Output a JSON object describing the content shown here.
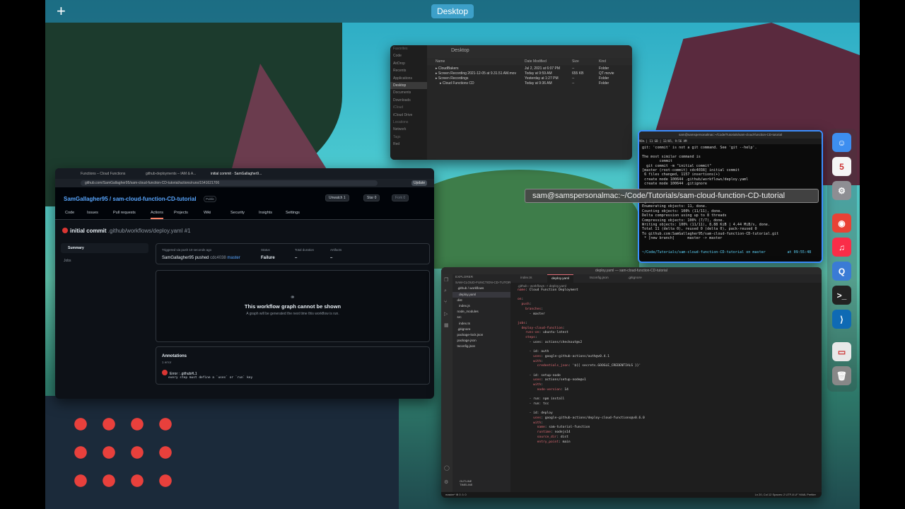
{
  "desktop": {
    "space_label": "Desktop",
    "add_space": "+"
  },
  "finder": {
    "title": "Desktop",
    "sidebar": [
      "Favorites",
      "Code",
      "AirDrop",
      "Recents",
      "Applications",
      "Desktop",
      "Documents",
      "Downloads",
      "iCloud",
      "iCloud Drive",
      "Locations",
      "Network",
      "Tags",
      "Red"
    ],
    "headers": {
      "name": "Name",
      "date": "Date Modified",
      "size": "Size",
      "kind": "Kind"
    },
    "rows": [
      {
        "name": "CloudBakers",
        "date": "Jul 2, 2021 at 6:07 PM",
        "size": "--",
        "kind": "Folder"
      },
      {
        "name": "Screen Recording 2021-12-05 at 9.31.51 AM.mov",
        "date": "Today at 9:59 AM",
        "size": "655 KB",
        "kind": "QT movie"
      },
      {
        "name": "Screen Recordings",
        "date": "Yesterday at 1:27 PM",
        "size": "--",
        "kind": "Folder"
      },
      {
        "name": "Cloud Functions CD",
        "date": "Today at 9:36 AM",
        "size": "--",
        "kind": "Folder"
      }
    ]
  },
  "browser": {
    "tabs": [
      "Functions – Cloud Functions",
      "github-deployments – IAM & A...",
      "initial commit · SamGallagher9..."
    ],
    "url": "github.com/SamGallagher95/sam-cloud-function-CD-tutorial/actions/runs/1541621706",
    "update": "Update",
    "repo": "SamGallagher95 / sam-cloud-function-CD-tutorial",
    "public": "Public",
    "unwatch": "Unwatch",
    "unwatch_count": "1",
    "star": "Star",
    "star_count": "0",
    "fork": "Fork",
    "fork_count": "0",
    "nav": [
      "Code",
      "Issues",
      "Pull requests",
      "Actions",
      "Projects",
      "Wiki",
      "Security",
      "Insights",
      "Settings"
    ],
    "run_title": "initial commit",
    "run_sub": ".github/workflows/deploy.yaml #1",
    "side_summary": "Summary",
    "side_jobs": "Jobs",
    "summary": {
      "trigger_label": "Triggered via push 10 seconds ago",
      "actor": "SamGallagher95 pushed",
      "commit": "cdc4038",
      "branch": "master",
      "status_label": "Status",
      "status": "Failure",
      "duration_label": "Total duration",
      "duration": "–",
      "artifacts_label": "Artifacts",
      "artifacts": "–"
    },
    "graph_title": "This workflow graph cannot be shown",
    "graph_sub": "A graph will be generated the next time this workflow is run.",
    "annotations_title": "Annotations",
    "annotations_count": "1 error",
    "error_title": "Error : .github#L1",
    "error_msg": "every step must define a `uses` or `run` key"
  },
  "terminal": {
    "title": "sam@samspersonalmac:~/Code/Tutorials/sam-cloud-function-CD-tutorial",
    "status": "96%   |   11 GB   |   12/05, 9:56 AM",
    "lines": [
      "git: 'commit' is not a git command. See 'git --help'.",
      "",
      "The most similar command is",
      "        commit",
      "  git commit -m \"initial commit\"",
      "[master (root-commit) cdc4038] initial commit",
      " 6 files changed, 1157 insertions(+)",
      " create mode 100644 .github/workflows/deploy.yaml",
      " create mode 100644 .gitignore",
      "",
      "",
      "",
      " git push",
      "Enumerating objects: 11, done.",
      "Counting objects: 100% (11/11), done.",
      "Delta compression using up to 8 threads",
      "Compressing objects: 100% (7/7), done.",
      "Writing objects: 100% (11/11), 8.88 KiB | 4.44 MiB/s, done.",
      "Total 11 (delta 0), reused 0 (delta 0), pack-reused 0",
      "To github.com:SamGallagher95/sam-cloud-function-CD-tutorial.git",
      " * [new branch]      master -> master"
    ],
    "prompt": "~/Code/Tutorials/sam-cloud-function-CD-tutorial on master          at 09:55:48",
    "tooltip": "sam@samspersonalmac:~/Code/Tutorials/sam-cloud-function-CD-tutorial"
  },
  "vscode": {
    "title": "deploy.yaml — sam-cloud-function-CD-tutorial",
    "explorer": [
      "EXPLORER",
      "SAM-CLOUD-FUNCTION-CD-TUTORIAL",
      "  .github / workflows",
      "    deploy.yaml",
      "  dist",
      "    index.js",
      "  node_modules",
      "  src",
      "    index.ts",
      "  .gitignore",
      "  package-lock.json",
      "  package.json",
      "  tsconfig.json"
    ],
    "tabs": [
      "index.ts",
      "deploy.yaml",
      "tsconfig.json",
      ".gitignore"
    ],
    "breadcrumb": ".github › workflows › ! deploy.yaml",
    "code": [
      [
        "name",
        ": Cloud Function Deployment"
      ],
      [
        "",
        ""
      ],
      [
        "on",
        ":"
      ],
      [
        "  push",
        ":"
      ],
      [
        "    branches",
        ":"
      ],
      [
        "",
        "      - master"
      ],
      [
        "",
        ""
      ],
      [
        "jobs",
        ":"
      ],
      [
        "  deploy-cloud-function",
        ":"
      ],
      [
        "    runs-on",
        ": ubuntu-latest"
      ],
      [
        "    steps",
        ":"
      ],
      [
        "",
        "      - uses: actions/checkout@v2"
      ],
      [
        "",
        ""
      ],
      [
        "",
        "      - id: auth"
      ],
      [
        "        uses",
        ": google-github-actions/auth@v0.4.1"
      ],
      [
        "        with",
        ":"
      ],
      [
        "          credentials_json",
        ": '${{ secrets.GOOGLE_CREDENTIALS }}'"
      ],
      [
        "",
        ""
      ],
      [
        "",
        "      - id: setup-node"
      ],
      [
        "        uses",
        ": actions/setup-node@v1"
      ],
      [
        "        with",
        ":"
      ],
      [
        "          node-version",
        ": 14"
      ],
      [
        "",
        ""
      ],
      [
        "",
        "      - run: npm install"
      ],
      [
        "",
        "      - run: tsc"
      ],
      [
        "",
        ""
      ],
      [
        "",
        "      - id: deploy"
      ],
      [
        "        uses",
        ": google-github-actions/deploy-cloud-functions@v0.6.0"
      ],
      [
        "        with",
        ":"
      ],
      [
        "          name",
        ": sam-tutorial-function"
      ],
      [
        "          runtime",
        ": nodejs14"
      ],
      [
        "          source_dir",
        ": dist"
      ],
      [
        "          entry_point",
        ": main"
      ]
    ],
    "outline": [
      "OUTLINE",
      "TIMELINE"
    ],
    "status_left": "master*   ⊗ 0 ⚠ 0",
    "status_right": "Ln 20, Col 12   Spaces: 2   UTF-8   LF   YAML   Prettier"
  },
  "dock": [
    {
      "name": "finder-icon",
      "glyph": "☺",
      "color": "#3d8ef0"
    },
    {
      "name": "calendar-icon",
      "glyph": "5",
      "color": "#f5f5f5"
    },
    {
      "name": "system-preferences-icon",
      "glyph": "⚙",
      "color": "#8e8e93"
    },
    {
      "name": "chrome-icon",
      "glyph": "◉",
      "color": "#e94235"
    },
    {
      "name": "music-icon",
      "glyph": "♫",
      "color": "#fa2d48"
    },
    {
      "name": "quicktime-icon",
      "glyph": "Q",
      "color": "#3a7bd5"
    },
    {
      "name": "terminal-icon",
      "glyph": ">_",
      "color": "#222"
    },
    {
      "name": "vscode-icon",
      "glyph": "⟩",
      "color": "#0f6ab4"
    },
    {
      "name": "document-icon",
      "glyph": "▭",
      "color": "#e8e8e8"
    },
    {
      "name": "trash-icon",
      "glyph": "🗑",
      "color": "#888"
    }
  ]
}
